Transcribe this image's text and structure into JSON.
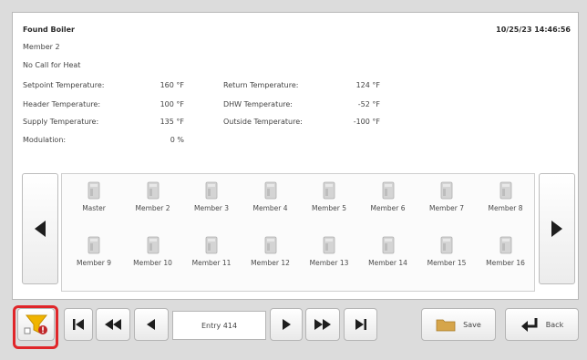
{
  "header": {
    "title": "Found Boiler",
    "timestamp": "10/25/23 14:46:56",
    "member": "Member 2",
    "status": "No Call for Heat"
  },
  "stats": {
    "setpoint_label": "Setpoint Temperature:",
    "setpoint_value": "160 °F",
    "return_label": "Return Temperature:",
    "return_value": "124 °F",
    "header_label": "Header Temperature:",
    "header_value": "100 °F",
    "dhw_label": "DHW Temperature:",
    "dhw_value": "-52 °F",
    "supply_label": "Supply Temperature:",
    "supply_value": "135 °F",
    "outside_label": "Outside Temperature:",
    "outside_value": "-100 °F",
    "modulation_label": "Modulation:",
    "modulation_value": "0 %"
  },
  "members": [
    "Master",
    "Member 2",
    "Member 3",
    "Member 4",
    "Member 5",
    "Member 6",
    "Member 7",
    "Member 8",
    "Member 9",
    "Member 10",
    "Member 11",
    "Member 12",
    "Member 13",
    "Member 14",
    "Member 15",
    "Member 16"
  ],
  "toolbar": {
    "entry_label": "Entry 414",
    "save_label": "Save",
    "back_label": "Back"
  },
  "colors": {
    "highlight": "#e0262a",
    "filter_icon": "#f0b400",
    "folder": "#d6a54a",
    "arrow": "#1e1e1e"
  },
  "icons": {
    "filter": "filter-alert-icon",
    "first": "first-record-icon",
    "fast_back": "fast-rewind-icon",
    "prev": "previous-icon",
    "next": "next-icon",
    "fast_fwd": "fast-forward-icon",
    "last": "last-record-icon",
    "save": "folder-icon",
    "back": "back-arrow-icon",
    "member": "boiler-icon"
  }
}
